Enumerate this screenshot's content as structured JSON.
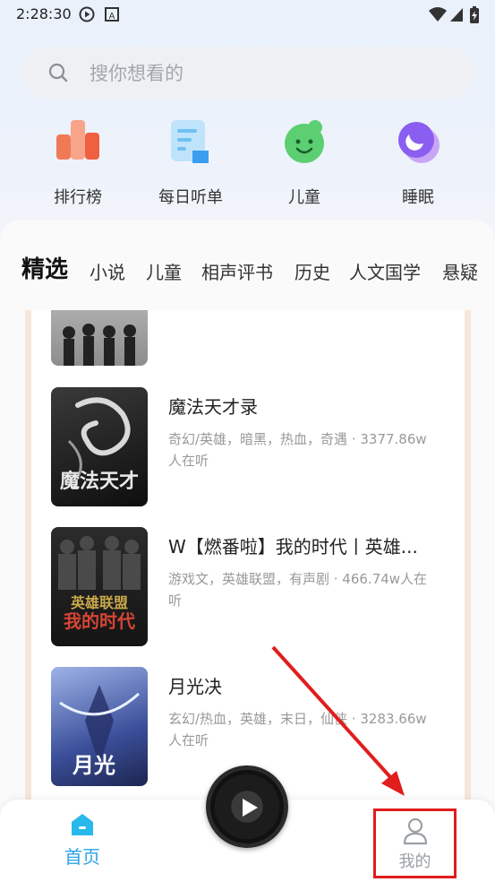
{
  "status_bar": {
    "time": "2:28:30",
    "icons": [
      "play-circle-icon",
      "a-badge-icon",
      "wifi-icon",
      "signal-icon",
      "battery-charging-icon"
    ]
  },
  "search": {
    "placeholder": "搜你想看的",
    "icon": "search-icon"
  },
  "quick_entries": [
    {
      "label": "排行榜",
      "icon": "ranking-icon"
    },
    {
      "label": "每日听单",
      "icon": "daily-list-icon"
    },
    {
      "label": "儿童",
      "icon": "kids-icon"
    },
    {
      "label": "睡眠",
      "icon": "sleep-icon"
    }
  ],
  "tabs": [
    "精选",
    "小说",
    "儿童",
    "相声评书",
    "历史",
    "人文国学",
    "悬疑"
  ],
  "books": [
    {
      "title": "魔法天才录",
      "meta": "奇幻/英雄，暗黑，热血，奇遇 · 3377.86w人在听"
    },
    {
      "title": "W【燃番啦】我的时代丨英雄...",
      "meta": "游戏文，英雄联盟，有声剧 · 466.74w人在听"
    },
    {
      "title": "月光决",
      "meta": "玄幻/热血，英雄，末日，仙侠 · 3283.66w人在听"
    }
  ],
  "bottom_nav": {
    "home": "首页",
    "mine": "我的"
  },
  "colors": {
    "accent": "#2aa3e8",
    "highlight_box": "#e11d1d",
    "arrow": "#e11d1d"
  }
}
